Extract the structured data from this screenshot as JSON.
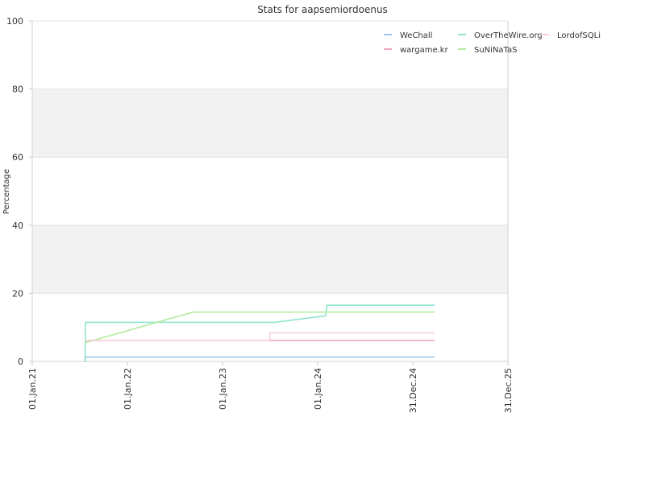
{
  "chart_data": {
    "type": "line",
    "title": "Stats for aapsemiordoenus",
    "xlabel": "",
    "ylabel": "Percentage",
    "xlim": [
      "2021-01-01",
      "2025-12-31"
    ],
    "ylim": [
      0,
      100
    ],
    "x_ticks": [
      {
        "label": "01.Jan.21",
        "date": "2021-01-01"
      },
      {
        "label": "01.Jan.22",
        "date": "2022-01-01"
      },
      {
        "label": "01.Jan.23",
        "date": "2023-01-01"
      },
      {
        "label": "01.Jan.24",
        "date": "2024-01-01"
      },
      {
        "label": "31.Dec.24",
        "date": "2024-12-31"
      },
      {
        "label": "31.Dec.25",
        "date": "2025-12-31"
      }
    ],
    "y_ticks": [
      {
        "label": "0",
        "value": 0
      },
      {
        "label": "20",
        "value": 20
      },
      {
        "label": "40",
        "value": 40
      },
      {
        "label": "60",
        "value": 60
      },
      {
        "label": "80",
        "value": 80
      },
      {
        "label": "100",
        "value": 100
      }
    ],
    "bands": [
      [
        20,
        40
      ],
      [
        60,
        80
      ]
    ],
    "legend_position": "top-right",
    "series": [
      {
        "name": "WeChall",
        "color": "#9cc6e9",
        "step": true,
        "points": [
          [
            "2021-07-21",
            0
          ],
          [
            "2021-07-24",
            1.3
          ],
          [
            "2025-03-25",
            1.3
          ]
        ]
      },
      {
        "name": "wargame.kr",
        "color": "#f0a7b9",
        "step": true,
        "points": [
          [
            "2021-07-23",
            6.2
          ],
          [
            "2025-03-25",
            6.2
          ]
        ]
      },
      {
        "name": "OverTheWire.org",
        "color": "#8fe4cf",
        "step": false,
        "points": [
          [
            "2021-07-23",
            0
          ],
          [
            "2021-07-24",
            11.5
          ],
          [
            "2023-07-20",
            11.5
          ],
          [
            "2024-02-01",
            13.4
          ],
          [
            "2024-02-05",
            16.5
          ],
          [
            "2025-03-25",
            16.5
          ]
        ]
      },
      {
        "name": "SuNiNaTaS",
        "color": "#b5eca3",
        "step": false,
        "points": [
          [
            "2021-07-23",
            5.5
          ],
          [
            "2022-09-10",
            14.5
          ],
          [
            "2025-03-25",
            14.5
          ]
        ]
      },
      {
        "name": "LordofSQLi",
        "color": "#f8cfd8",
        "step": true,
        "points": [
          [
            "2021-07-23",
            6.2
          ],
          [
            "2023-07-01",
            8.4
          ],
          [
            "2025-03-25",
            8.4
          ]
        ]
      }
    ]
  }
}
